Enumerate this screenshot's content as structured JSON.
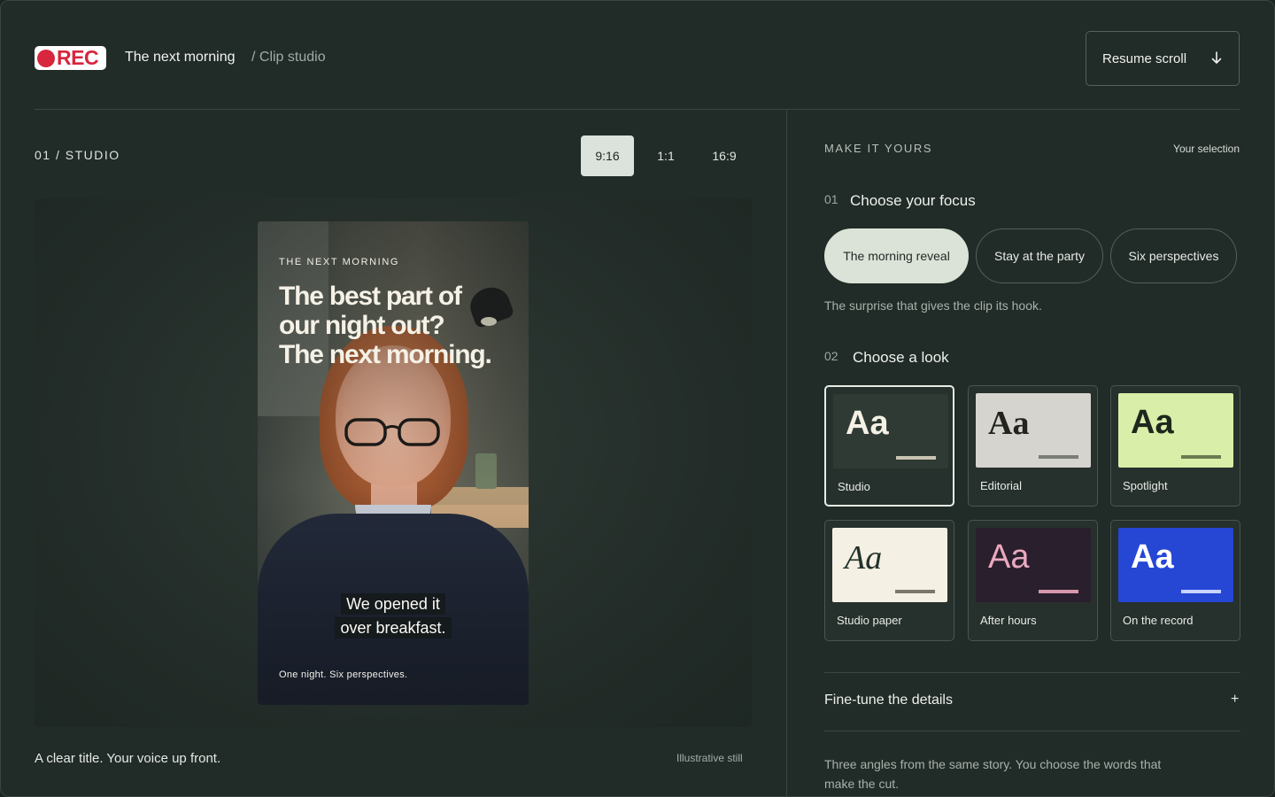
{
  "header": {
    "logo_text": "REC",
    "title": "The next morning",
    "subtitle": "/ Clip studio",
    "resume_label": "Resume scroll",
    "resume_icon": "arrow-down-icon"
  },
  "studio": {
    "label": "01 / STUDIO",
    "ratios": [
      {
        "label": "9:16",
        "active": true
      },
      {
        "label": "1:1",
        "active": false
      },
      {
        "label": "16:9",
        "active": false
      }
    ],
    "preview": {
      "kicker": "THE NEXT MORNING",
      "headline_line1": "The best part of",
      "headline_line2": "our night out?",
      "headline_line3": "The next morning.",
      "caption_line1": "We opened it",
      "caption_line2": "over breakfast.",
      "tagline": "One night. Six perspectives."
    },
    "note": "A clear title. Your voice up front.",
    "still_note": "Illustrative still"
  },
  "customize": {
    "label": "MAKE IT YOURS",
    "selection_link": "Your selection",
    "focus": {
      "number": "01",
      "title": "Choose your focus",
      "options": [
        {
          "label": "The morning reveal",
          "active": true
        },
        {
          "label": "Stay at the party",
          "active": false
        },
        {
          "label": "Six perspectives",
          "active": false
        }
      ],
      "description": "The surprise that gives the clip its hook."
    },
    "look": {
      "number": "02",
      "title": "Choose a look",
      "sample": "Aa",
      "options": [
        {
          "name": "Studio",
          "active": true,
          "bg": "#2e3a33",
          "fg": "#f4f0e4",
          "bar": "#c9c3b2"
        },
        {
          "name": "Editorial",
          "active": false,
          "bg": "#d6d4cf",
          "fg": "#23241f",
          "bar": "#7b7d78"
        },
        {
          "name": "Spotlight",
          "active": false,
          "bg": "#d9eea8",
          "fg": "#1e271c",
          "bar": "#6a7d50"
        },
        {
          "name": "Studio paper",
          "active": false,
          "bg": "#f4f0e3",
          "fg": "#22312a",
          "bar": "#7a786c"
        },
        {
          "name": "After hours",
          "active": false,
          "bg": "#2a1f2c",
          "fg": "#e9a9bf",
          "bar": "#d798ae"
        },
        {
          "name": "On the record",
          "active": false,
          "bg": "#2646d4",
          "fg": "#ffffff",
          "bar": "#c8d3ff"
        }
      ]
    },
    "fine_tune": {
      "label": "Fine-tune the details",
      "toggle": "+"
    },
    "footer_text": "Three angles from the same story. You choose the words that make the cut."
  }
}
